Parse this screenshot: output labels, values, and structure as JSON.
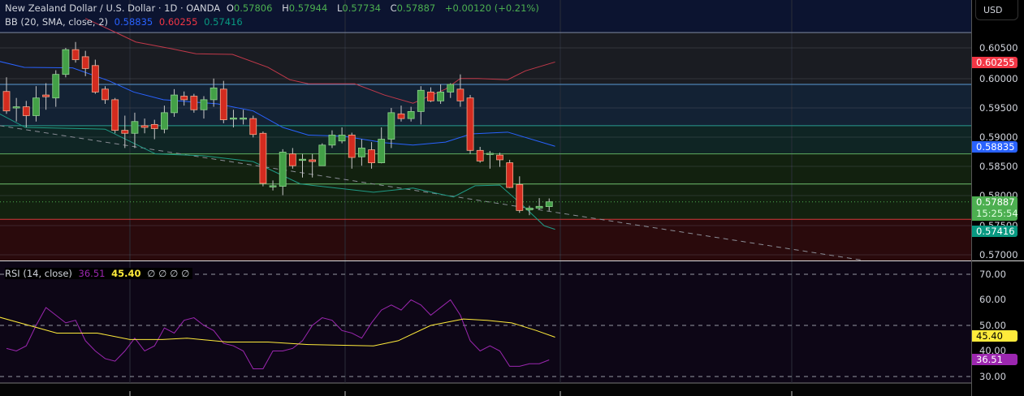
{
  "header": {
    "symbol": "New Zealand Dollar / U.S. Dollar · 1D · OANDA",
    "o_label": "O",
    "o": "0.57806",
    "h_label": "H",
    "h": "0.57944",
    "l_label": "L",
    "l": "0.57734",
    "c_label": "C",
    "c": "0.57887",
    "change": "+0.00120 (+0.21%)"
  },
  "bb": {
    "label": "BB (20, SMA, close, 2)",
    "basis": "0.58835",
    "upper": "0.60255",
    "lower": "0.57416"
  },
  "rsi": {
    "label": "RSI (14, close)",
    "value": "36.51",
    "ma": "45.40",
    "na": [
      "∅",
      "∅",
      "∅",
      "∅"
    ]
  },
  "axis": {
    "currency": "USD",
    "price_ticks": [
      "0.60500",
      "0.60000",
      "0.59500",
      "0.59000",
      "0.58500",
      "0.58000",
      "0.57500",
      "0.57000"
    ],
    "rsi_ticks": [
      "70.00",
      "60.00",
      "50.00",
      "40.00",
      "30.00"
    ],
    "badges": {
      "upper": "0.60255",
      "basis": "0.58835",
      "last": "0.57887",
      "countdown": "15:25:54",
      "lower": "0.57416",
      "rsi_ma": "45.40",
      "rsi": "36.51"
    }
  },
  "colors": {
    "up": "#43a047",
    "down": "#d32b1f",
    "bb_upper": "#c2394a",
    "bb_basis": "#2962ff",
    "bb_lower": "#1f9a86",
    "rsi": "#9c27b0",
    "rsi_ma": "#ffeb3b"
  },
  "chart_data": {
    "type": "candlestick",
    "price_range": [
      0.569,
      0.6095
    ],
    "candles": [
      [
        0.5976,
        0.6,
        0.5938,
        0.5943
      ],
      [
        0.595,
        0.5965,
        0.5925,
        0.595
      ],
      [
        0.595,
        0.596,
        0.5915,
        0.5935
      ],
      [
        0.5935,
        0.5985,
        0.5925,
        0.5965
      ],
      [
        0.597,
        0.599,
        0.5945,
        0.5967
      ],
      [
        0.5965,
        0.6012,
        0.595,
        0.6005
      ],
      [
        0.6005,
        0.605,
        0.6,
        0.6047
      ],
      [
        0.6047,
        0.606,
        0.6025,
        0.603
      ],
      [
        0.6035,
        0.6045,
        0.6002,
        0.6015
      ],
      [
        0.602,
        0.603,
        0.5972,
        0.5975
      ],
      [
        0.598,
        0.5985,
        0.5955,
        0.5962
      ],
      [
        0.5962,
        0.5965,
        0.5905,
        0.591
      ],
      [
        0.591,
        0.5935,
        0.588,
        0.5905
      ],
      [
        0.5905,
        0.594,
        0.588,
        0.5925
      ],
      [
        0.5918,
        0.593,
        0.5905,
        0.5915
      ],
      [
        0.592,
        0.5928,
        0.5895,
        0.5913
      ],
      [
        0.5912,
        0.5952,
        0.5905,
        0.594
      ],
      [
        0.594,
        0.598,
        0.5933,
        0.597
      ],
      [
        0.5968,
        0.5976,
        0.5952,
        0.5962
      ],
      [
        0.5968,
        0.5972,
        0.594,
        0.5945
      ],
      [
        0.5945,
        0.5968,
        0.593,
        0.5962
      ],
      [
        0.5962,
        0.5998,
        0.595,
        0.5982
      ],
      [
        0.598,
        0.5994,
        0.5922,
        0.5928
      ],
      [
        0.593,
        0.5945,
        0.5915,
        0.5931
      ],
      [
        0.593,
        0.5945,
        0.592,
        0.5931
      ],
      [
        0.593,
        0.5935,
        0.5898,
        0.5903
      ],
      [
        0.5905,
        0.5908,
        0.5815,
        0.582
      ],
      [
        0.5815,
        0.5825,
        0.5808,
        0.5816
      ],
      [
        0.5815,
        0.5878,
        0.58,
        0.5873
      ],
      [
        0.587,
        0.588,
        0.5845,
        0.585
      ],
      [
        0.586,
        0.587,
        0.583,
        0.5861
      ],
      [
        0.586,
        0.587,
        0.583,
        0.5857
      ],
      [
        0.585,
        0.5888,
        0.585,
        0.5885
      ],
      [
        0.5885,
        0.591,
        0.588,
        0.5902
      ],
      [
        0.5892,
        0.5915,
        0.5888,
        0.5902
      ],
      [
        0.5902,
        0.5906,
        0.5845,
        0.5864
      ],
      [
        0.5865,
        0.5895,
        0.585,
        0.588
      ],
      [
        0.5877,
        0.589,
        0.5845,
        0.5855
      ],
      [
        0.5855,
        0.5915,
        0.5854,
        0.5895
      ],
      [
        0.5895,
        0.5948,
        0.588,
        0.594
      ],
      [
        0.5938,
        0.5952,
        0.5925,
        0.593
      ],
      [
        0.593,
        0.595,
        0.5925,
        0.5942
      ],
      [
        0.5942,
        0.5985,
        0.592,
        0.5978
      ],
      [
        0.5975,
        0.5983,
        0.5958,
        0.596
      ],
      [
        0.596,
        0.5988,
        0.5955,
        0.5975
      ],
      [
        0.5975,
        0.599,
        0.5965,
        0.5988
      ],
      [
        0.598,
        0.6005,
        0.595,
        0.596
      ],
      [
        0.5965,
        0.597,
        0.587,
        0.5876
      ],
      [
        0.5876,
        0.5882,
        0.5855,
        0.5858
      ],
      [
        0.587,
        0.5875,
        0.5845,
        0.5871
      ],
      [
        0.5868,
        0.5872,
        0.5848,
        0.586
      ],
      [
        0.5855,
        0.586,
        0.5812,
        0.5813
      ],
      [
        0.5818,
        0.5832,
        0.577,
        0.5774
      ],
      [
        0.5775,
        0.5782,
        0.5766,
        0.5778
      ],
      [
        0.5778,
        0.5795,
        0.5776,
        0.5781
      ],
      [
        0.57806,
        0.57944,
        0.57734,
        0.57887
      ]
    ],
    "bb_upper": [
      [
        8,
        0.61
      ],
      [
        11.1,
        0.6076
      ],
      [
        13.1,
        0.606
      ],
      [
        16.6,
        0.6049
      ],
      [
        19.2,
        0.604
      ],
      [
        22.9,
        0.6039
      ],
      [
        26.5,
        0.6017
      ],
      [
        28.7,
        0.5996
      ],
      [
        30.6,
        0.5989
      ],
      [
        35.3,
        0.5989
      ],
      [
        38.3,
        0.597
      ],
      [
        41.2,
        0.5956
      ],
      [
        44.5,
        0.598
      ],
      [
        46,
        0.5998
      ],
      [
        47.8,
        0.5998
      ],
      [
        50.8,
        0.5996
      ],
      [
        52.6,
        0.6011
      ],
      [
        55.6,
        0.6026
      ]
    ],
    "bb_basis": [
      [
        -0.7,
        0.6027
      ],
      [
        1.8,
        0.6017
      ],
      [
        6.7,
        0.6016
      ],
      [
        10.4,
        0.5994
      ],
      [
        12.9,
        0.5975
      ],
      [
        15.9,
        0.5962
      ],
      [
        21.4,
        0.5955
      ],
      [
        25,
        0.5943
      ],
      [
        28,
        0.5915
      ],
      [
        30.6,
        0.5902
      ],
      [
        34.2,
        0.59
      ],
      [
        38.3,
        0.5889
      ],
      [
        41.2,
        0.5885
      ],
      [
        44.5,
        0.589
      ],
      [
        47.1,
        0.5904
      ],
      [
        50.8,
        0.5907
      ],
      [
        55.6,
        0.5883
      ]
    ],
    "bb_lower": [
      [
        -0.7,
        0.5938
      ],
      [
        1.9,
        0.5915
      ],
      [
        10,
        0.5912
      ],
      [
        15.1,
        0.587
      ],
      [
        19.9,
        0.5867
      ],
      [
        25,
        0.5857
      ],
      [
        29.8,
        0.5819
      ],
      [
        37.2,
        0.5805
      ],
      [
        41.2,
        0.5812
      ],
      [
        45.3,
        0.5797
      ],
      [
        47.5,
        0.5816
      ],
      [
        50,
        0.5817
      ],
      [
        52.3,
        0.5783
      ],
      [
        54.5,
        0.5748
      ],
      [
        55.6,
        0.5742
      ]
    ],
    "trendline": [
      [
        -0.7,
        0.5918
      ],
      [
        86.6,
        0.569
      ]
    ],
    "levels": [
      0.6076,
      0.5988,
      0.5918,
      0.587,
      0.5819,
      0.5759
    ],
    "last_price": 0.57887,
    "rsi_values": [
      41,
      40,
      42,
      50,
      57,
      54,
      51,
      52,
      44,
      40,
      37,
      36,
      40,
      45,
      40,
      42,
      49,
      47,
      52,
      53,
      50,
      48,
      43,
      42,
      40,
      33,
      33,
      40,
      40,
      41,
      44,
      50,
      53,
      52,
      48,
      47,
      45,
      51,
      56,
      58,
      56,
      60,
      58,
      54,
      57,
      60,
      54,
      44,
      40,
      42,
      40,
      34,
      34,
      35,
      35,
      36.51
    ],
    "rsi_ma": [
      [
        -0.7,
        53.2
      ],
      [
        5.1,
        47
      ],
      [
        9.2,
        47
      ],
      [
        12.5,
        44.5
      ],
      [
        15.8,
        44.5
      ],
      [
        18.3,
        45
      ],
      [
        22.4,
        43.5
      ],
      [
        26.5,
        43.5
      ],
      [
        30.6,
        42.5
      ],
      [
        37.2,
        42
      ],
      [
        39.7,
        44
      ],
      [
        43,
        50
      ],
      [
        46.3,
        52.5
      ],
      [
        48.7,
        52
      ],
      [
        51.2,
        51
      ],
      [
        53.7,
        48
      ],
      [
        55.6,
        45.4
      ]
    ],
    "rsi_range": [
      30,
      70
    ],
    "rsi_bands": [
      70,
      50,
      30
    ]
  }
}
